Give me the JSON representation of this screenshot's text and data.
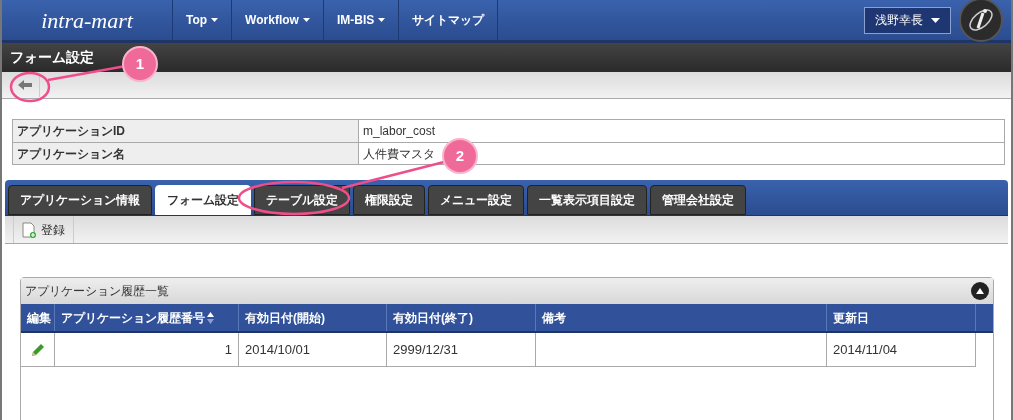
{
  "header": {
    "logo": "intra-mart",
    "nav": [
      {
        "label": "Top",
        "dropdown": true
      },
      {
        "label": "Workflow",
        "dropdown": true
      },
      {
        "label": "IM-BIS",
        "dropdown": true
      },
      {
        "label": "サイトマップ",
        "dropdown": false
      }
    ],
    "user": "浅野幸長"
  },
  "page_title": "フォーム設定",
  "info": [
    {
      "label": "アプリケーションID",
      "value": "m_labor_cost"
    },
    {
      "label": "アプリケーション名",
      "value": "人件費マスタ"
    }
  ],
  "tabs": [
    {
      "label": "アプリケーション情報",
      "selected": false
    },
    {
      "label": "フォーム設定",
      "selected": true
    },
    {
      "label": "テーブル設定",
      "selected": false
    },
    {
      "label": "権限設定",
      "selected": false
    },
    {
      "label": "メニュー設定",
      "selected": false
    },
    {
      "label": "一覧表示項目設定",
      "selected": false
    },
    {
      "label": "管理会社設定",
      "selected": false
    }
  ],
  "toolbar": {
    "register": "登録"
  },
  "panel": {
    "title": "アプリケーション履歴一覧",
    "columns": [
      "編集",
      "アプリケーション履歴番号",
      "有効日付(開始)",
      "有効日付(終了)",
      "備考",
      "更新日"
    ],
    "rows": [
      {
        "number": "1",
        "start": "2014/10/01",
        "end": "2999/12/31",
        "note": "",
        "updated": "2014/11/04"
      }
    ]
  },
  "callouts": [
    {
      "number": "1"
    },
    {
      "number": "2"
    }
  ]
}
